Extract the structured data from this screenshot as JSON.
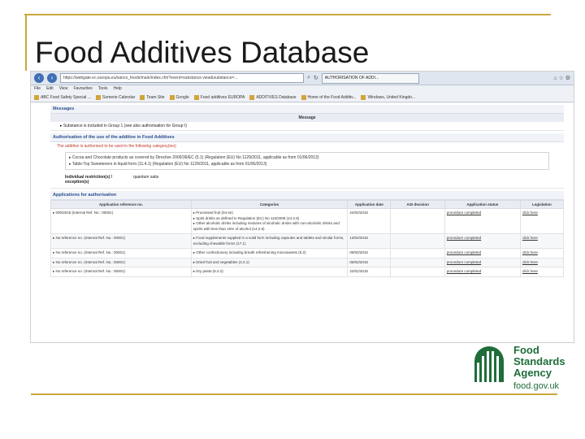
{
  "slide": {
    "title": "Food Additives Database"
  },
  "browser": {
    "url": "https://webgate.ec.europa.eu/sanco_foods/main/index.cfm?event=substance.view&substance=...",
    "tab_title": "AUTHORISATION OF ADDI...",
    "menu": [
      "File",
      "Edit",
      "View",
      "Favourites",
      "Tools",
      "Help"
    ],
    "favourites": [
      "ABC Food Safety Special ...",
      "Somerie Calendar",
      "Team Site",
      "Google",
      "Food additives EUROPA",
      "ADDITIVES Database",
      "Home of the Food Additiv...",
      "Windows, United Kingdo..."
    ]
  },
  "messages": {
    "title": "Messages",
    "column": "Message",
    "text": "Substance is included in Group 1 (see also authorisation for Group I)"
  },
  "authorisation": {
    "title": "Authorisation of the use of the additive in Food Additives",
    "note": "The additive is authorised to be used in the following category(ies):",
    "categories": [
      "Cocoa and Chocolate products as covered by Directive 2000/36/EC (5.1) (Regulation (EU) No 1129/2011, applicable as from 01/06/2013)",
      "Table-Top Sweeteners in liquid form (11.4.1) (Regulation (EU) No 1129/2011, applicable as from 01/06/2013)"
    ],
    "restrictions_label": "Individual restriction(s) / exception(s)",
    "restrictions_value": "quantum satis"
  },
  "applications": {
    "title": "Applications for authorisation",
    "columns": [
      "Application reference no.",
      "Categories",
      "Application date",
      "AGI decision",
      "Application status",
      "Legislation"
    ],
    "rows": [
      {
        "ref": "000/2015 (Internal Ref. No.: 00001)",
        "categories": [
          "Processed fruit (04.4e)",
          "Spirit drinks as defined in Regulation (EC) No 110/2008 (14.2.6)",
          "Other alcoholic drinks including mixtures of alcoholic drinks with non-alcoholic drinks and spirits with less than 15% of alcohol (14.2.8)"
        ],
        "date": "24/02/2015",
        "agi": "",
        "status": "procedure completed",
        "legislation": "click here"
      },
      {
        "ref": "No reference no. (Internal Ref. No.: 00001)",
        "categories": [
          "Food supplements supplied in a solid form including capsules and tablets and similar forms, excluding chewable forms (17.1)"
        ],
        "date": "13/02/2015",
        "agi": "",
        "status": "procedure completed",
        "legislation": "click here"
      },
      {
        "ref": "No reference no. (Internal Ref. No.: 00001)",
        "categories": [
          "Other confectionery including breath refreshening microsweets (5.2)"
        ],
        "date": "09/02/2015",
        "agi": "",
        "status": "procedure completed",
        "legislation": "click here"
      },
      {
        "ref": "No reference no. (Internal Ref. No.: 00001)",
        "categories": [
          "Dried fruit and vegetables (4.2.1)"
        ],
        "date": "09/02/2015",
        "agi": "",
        "status": "procedure completed",
        "legislation": "click here"
      },
      {
        "ref": "No reference no. (Internal Ref. No.: 00001)",
        "categories": [
          "Dry pasta (6.4.2)"
        ],
        "date": "22/01/2015",
        "agi": "",
        "status": "procedure completed",
        "legislation": "click here"
      }
    ]
  },
  "logo": {
    "line1": "Food",
    "line2": "Standards",
    "line3": "Agency",
    "url": "food.gov.uk",
    "color": "#1f6d3a"
  }
}
